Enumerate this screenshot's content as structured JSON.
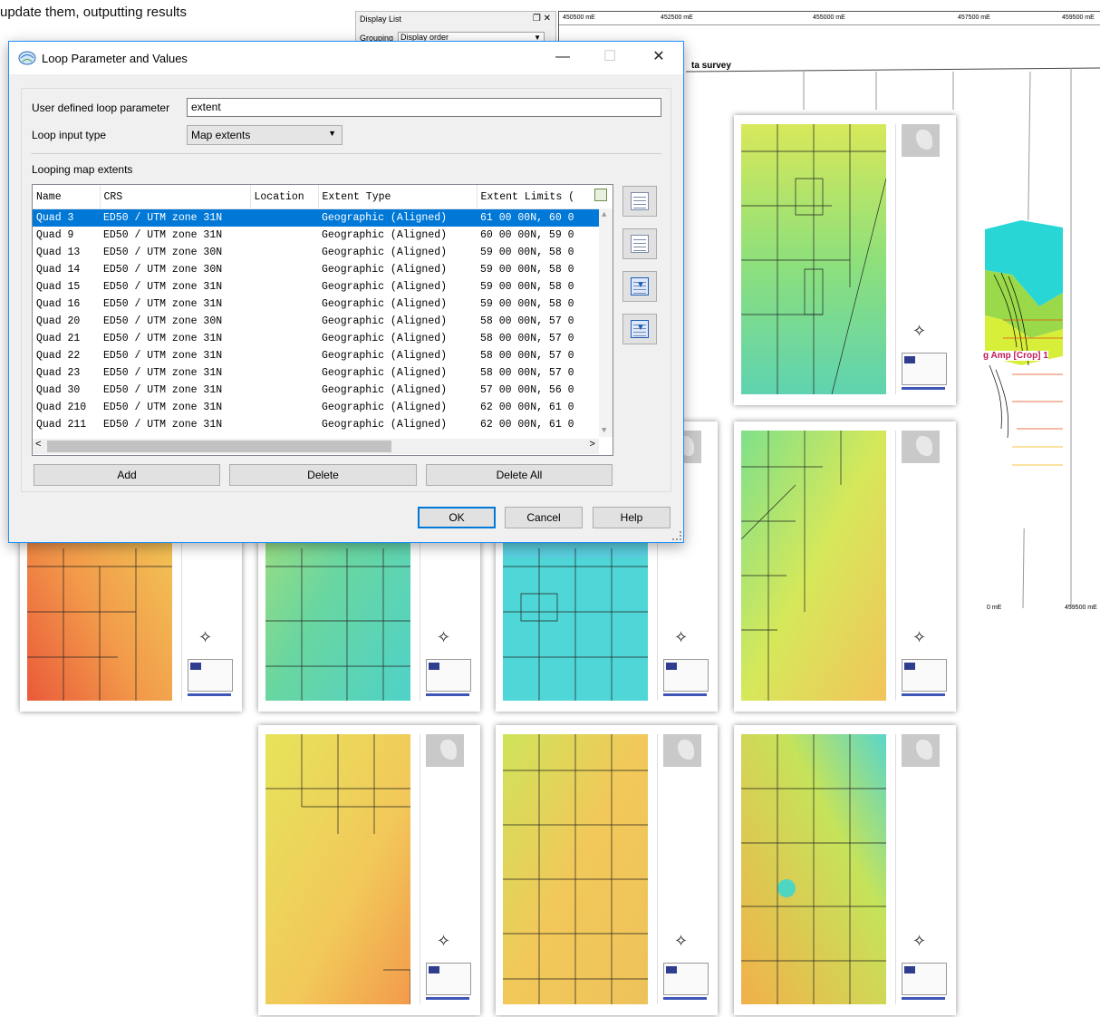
{
  "background": {
    "caption": "update them, outputting results",
    "display_list": {
      "title": "Display List",
      "icons": "❐ ✕",
      "grouping_label": "Grouping",
      "grouping_value": "Display order"
    },
    "map": {
      "top_eastings": [
        "450500 mE",
        "452500 mE",
        "455000 mE",
        "457500 mE",
        "459500 mE"
      ],
      "survey_label": "ta survey",
      "crop_label": "g Amp [Crop] 1",
      "bottom_eastings": [
        "0 mE",
        "459500 mE"
      ]
    }
  },
  "dialog": {
    "title": "Loop Parameter and Values",
    "min_icon": "—",
    "max_icon": "☐",
    "close_icon": "✕",
    "param_label": "User defined loop parameter",
    "param_value": "extent",
    "input_type_label": "Loop input type",
    "input_type_value": "Map extents",
    "combo_arrow": "▼",
    "list_label": "Looping map extents",
    "columns": [
      "Name",
      "CRS",
      "Location",
      "Extent Type",
      "Extent Limits ("
    ],
    "rows": [
      {
        "name": "Quad 3",
        "crs": "ED50 / UTM zone 31N",
        "location": "",
        "type": "Geographic (Aligned)",
        "limits": "61 00 00N, 60 0"
      },
      {
        "name": "Quad 9",
        "crs": "ED50 / UTM zone 31N",
        "location": "",
        "type": "Geographic (Aligned)",
        "limits": "60 00 00N, 59 0"
      },
      {
        "name": "Quad 13",
        "crs": "ED50 / UTM zone 30N",
        "location": "",
        "type": "Geographic (Aligned)",
        "limits": "59 00 00N, 58 0"
      },
      {
        "name": "Quad 14",
        "crs": "ED50 / UTM zone 30N",
        "location": "",
        "type": "Geographic (Aligned)",
        "limits": "59 00 00N, 58 0"
      },
      {
        "name": "Quad 15",
        "crs": "ED50 / UTM zone 31N",
        "location": "",
        "type": "Geographic (Aligned)",
        "limits": "59 00 00N, 58 0"
      },
      {
        "name": "Quad 16",
        "crs": "ED50 / UTM zone 31N",
        "location": "",
        "type": "Geographic (Aligned)",
        "limits": "59 00 00N, 58 0"
      },
      {
        "name": "Quad 20",
        "crs": "ED50 / UTM zone 30N",
        "location": "",
        "type": "Geographic (Aligned)",
        "limits": "58 00 00N, 57 0"
      },
      {
        "name": "Quad 21",
        "crs": "ED50 / UTM zone 31N",
        "location": "",
        "type": "Geographic (Aligned)",
        "limits": "58 00 00N, 57 0"
      },
      {
        "name": "Quad 22",
        "crs": "ED50 / UTM zone 31N",
        "location": "",
        "type": "Geographic (Aligned)",
        "limits": "58 00 00N, 57 0"
      },
      {
        "name": "Quad 23",
        "crs": "ED50 / UTM zone 31N",
        "location": "",
        "type": "Geographic (Aligned)",
        "limits": "58 00 00N, 57 0"
      },
      {
        "name": "Quad 30",
        "crs": "ED50 / UTM zone 31N",
        "location": "",
        "type": "Geographic (Aligned)",
        "limits": "57 00 00N, 56 0"
      },
      {
        "name": "Quad 210",
        "crs": "ED50 / UTM zone 31N",
        "location": "",
        "type": "Geographic (Aligned)",
        "limits": "62 00 00N, 61 0"
      },
      {
        "name": "Quad 211",
        "crs": "ED50 / UTM zone 31N",
        "location": "",
        "type": "Geographic (Aligned)",
        "limits": "62 00 00N, 61 0"
      }
    ],
    "selected_row": 0,
    "scroll_left_icon": "<",
    "scroll_right_icon": ">",
    "scroll_up_icon": "▲",
    "scroll_down_icon": "▼",
    "add_label": "Add",
    "delete_label": "Delete",
    "delete_all_label": "Delete All",
    "ok_label": "OK",
    "cancel_label": "Cancel",
    "help_label": "Help",
    "side_buttons": [
      "move-to-top-icon",
      "move-up-icon",
      "move-down-icon",
      "move-to-bottom-icon"
    ],
    "accent_color": "#0078d7"
  }
}
